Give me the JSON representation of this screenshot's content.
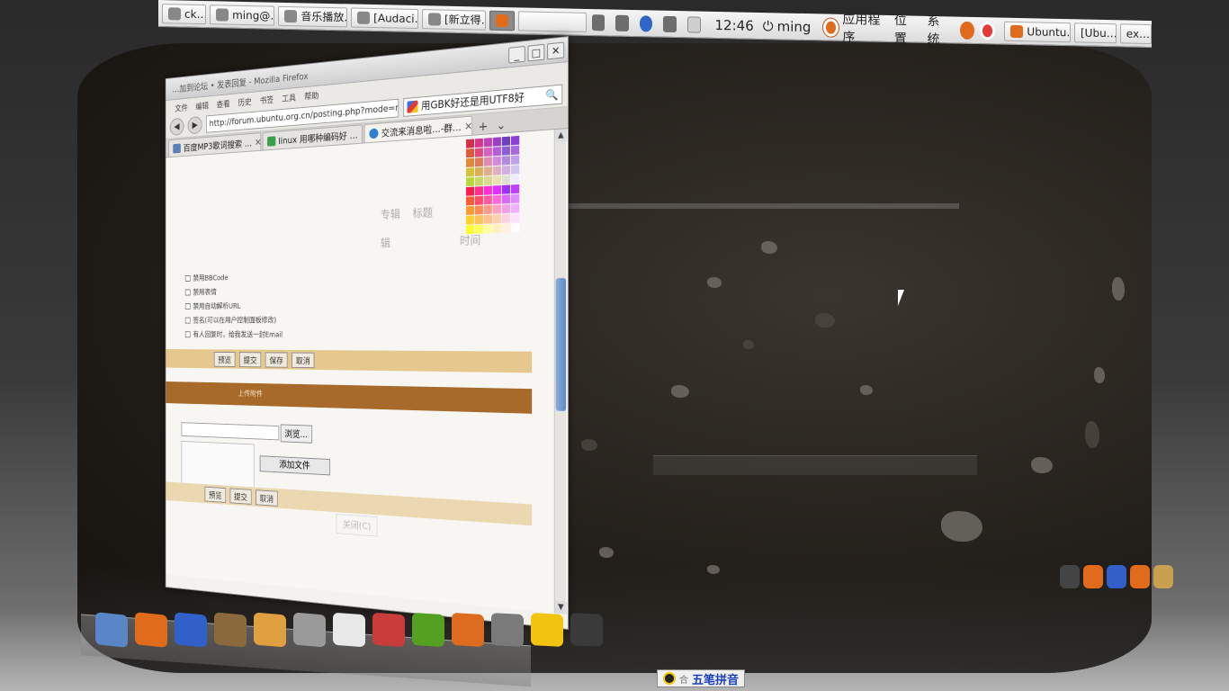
{
  "top_panel": {
    "tasks": [
      {
        "label": "ck…"
      },
      {
        "label": "ming@…"
      },
      {
        "label": "音乐播放…"
      },
      {
        "label": "[Audaci…"
      },
      {
        "label": "[新立得…"
      },
      {
        "label": ""
      }
    ],
    "clock": "12:46",
    "user": "ming",
    "menus": {
      "applications": "应用程序",
      "places": "位置",
      "system": "系统"
    },
    "right_tasks": [
      {
        "label": "Ubuntu…"
      },
      {
        "label": "[Ubu…"
      },
      {
        "label": "ex…"
      }
    ]
  },
  "firefox": {
    "title": "…加到论坛 • 发表回复 - Mozilla Firefox",
    "menu": [
      "文件",
      "编辑",
      "查看",
      "历史",
      "书签",
      "工具",
      "帮助"
    ],
    "url": "http://forum.ubuntu.org.cn/posting.php?mode=reply&f=126&t=2374",
    "search_value": "用GBK好还是用UTF8好",
    "tabs": [
      {
        "label": "百度MP3歌词搜索 …"
      },
      {
        "label": "linux 用哪种编码好 …"
      },
      {
        "label": "交流来消息啦…-群…"
      }
    ],
    "columns": {
      "album": "专辑",
      "title": "标题",
      "time": "时间",
      "col_left": "辑"
    },
    "options": [
      "禁用BBCode",
      "禁用表情",
      "禁用自动解析URL",
      "签名(可以在用户控制面板修改)",
      "有人回复时，给我发送一封Email"
    ],
    "strip_buttons": [
      "预览",
      "提交",
      "保存",
      "取消"
    ],
    "upload_label": "上传附件",
    "browse_label": "浏览...",
    "add_file_label": "添加文件",
    "bottom_buttons": [
      "预览",
      "提交",
      "取消"
    ],
    "close_label": "关闭(C)"
  },
  "palette_colors": [
    "#d62f4a",
    "#d6378c",
    "#c43fb7",
    "#9b3fc4",
    "#6a3fc4",
    "#8c3fd6",
    "#e05a3c",
    "#e0497e",
    "#d95fc4",
    "#b25fd9",
    "#8c5fd9",
    "#a66ae0",
    "#e08a3c",
    "#e07a5a",
    "#e08ab0",
    "#d08ad9",
    "#b08ae0",
    "#c0a0f0",
    "#d8c23c",
    "#d8b05a",
    "#e0b08a",
    "#e0b0c0",
    "#d0b0e0",
    "#d0c8f0",
    "#b8d83c",
    "#c8d86a",
    "#d8d890",
    "#e8e0b0",
    "#e0e0d0",
    "#ececff",
    "#ff1a4a",
    "#ff2f8c",
    "#ff2fd0",
    "#e02fff",
    "#a02fff",
    "#c040ff",
    "#ff5a2f",
    "#ff4a6a",
    "#ff5aa0",
    "#ff6ad8",
    "#d86aff",
    "#e08aff",
    "#ff9a2f",
    "#ff8a5a",
    "#ff9a8a",
    "#ffa0c0",
    "#f0a0e8",
    "#f0b0ff",
    "#ffd02f",
    "#ffc05a",
    "#ffc08a",
    "#ffd0b0",
    "#ffd0e0",
    "#ffe0ff",
    "#ffff2f",
    "#ffff5a",
    "#ffffa0",
    "#fff0c0",
    "#fff0e0",
    "#ffffff"
  ],
  "ime": {
    "text": "五笔拼音",
    "lock": "合"
  },
  "dock_icons": [
    "#5a86c8",
    "#e06b1a",
    "#3060c8",
    "#8a6a3c",
    "#e0a040",
    "#9a9a9a",
    "#e8e8e8",
    "#c83c3c",
    "#55a020",
    "#dd6b20",
    "#7a7a7a",
    "#f2c40f",
    "#3a3a3a"
  ],
  "right_dock_icons": [
    "#444444",
    "#e06b1a",
    "#3060c8",
    "#e06b1a",
    "#c8a050"
  ]
}
